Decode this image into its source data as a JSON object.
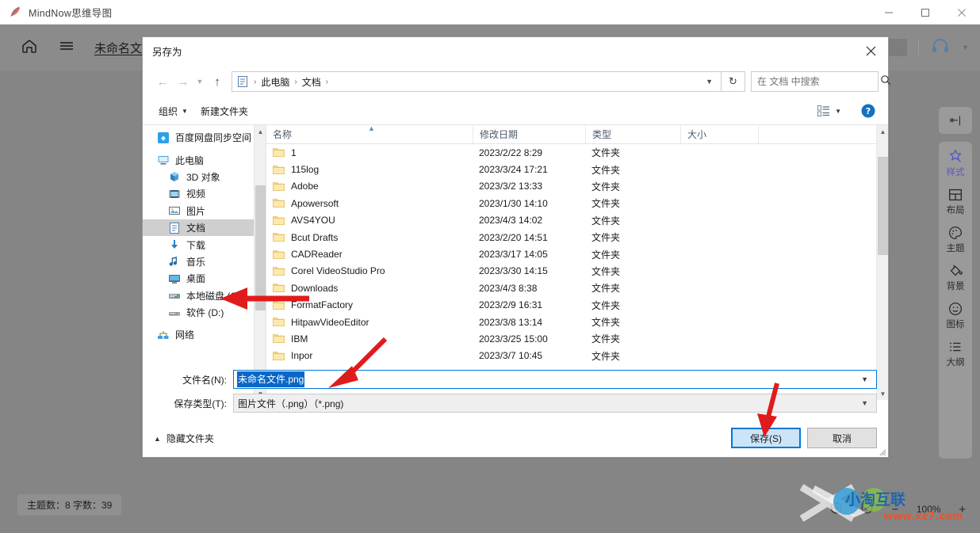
{
  "app": {
    "title": "MindNow思维导图",
    "logo_icon": "feather-logo-icon",
    "window_controls": {
      "minimize": "minimize-icon",
      "maximize": "maximize-icon",
      "close": "close-icon"
    },
    "header": {
      "home_icon": "home-icon",
      "menu_icon": "hamburger-menu-icon",
      "document_name": "未命名文件",
      "headset_icon": "headset-icon",
      "headset_caret": "chevron-down-icon"
    },
    "rail": {
      "collapse_icon": "collapse-panel-icon",
      "items": [
        {
          "label": "样式",
          "icon": "star-style-icon",
          "active": true
        },
        {
          "label": "布局",
          "icon": "layout-grid-icon",
          "active": false
        },
        {
          "label": "主题",
          "icon": "palette-theme-icon",
          "active": false
        },
        {
          "label": "背景",
          "icon": "paint-bucket-icon",
          "active": false
        },
        {
          "label": "图标",
          "icon": "smiley-face-icon",
          "active": false
        },
        {
          "label": "大纲",
          "icon": "outline-list-icon",
          "active": false
        }
      ]
    },
    "status": {
      "left_text": "主题数：8  字数：39",
      "globe_icon": "globe-icon",
      "compass_icon": "compass-icon",
      "zoom_out": "−",
      "zoom_level": "100%",
      "zoom_in": "+"
    },
    "watermark": {
      "brand": "小淘互联",
      "url": "www.xz7.com"
    }
  },
  "dialog": {
    "title": "另存为",
    "close_icon": "close-icon",
    "nav": {
      "back_icon": "arrow-left-icon",
      "forward_icon": "arrow-right-icon",
      "history_icon": "chevron-down-icon",
      "up_icon": "arrow-up-icon",
      "breadcrumb_icon": "documents-folder-icon",
      "crumbs": [
        "此电脑",
        "文档"
      ],
      "breadcrumb_caret": "chevron-down-icon",
      "refresh_icon": "refresh-icon",
      "search_placeholder": "在 文档 中搜索",
      "search_value": "",
      "search_icon": "search-icon"
    },
    "commands": {
      "organize_label": "组织",
      "organize_caret": "chevron-down-icon",
      "new_folder_label": "新建文件夹",
      "view_icon": "view-mode-icon",
      "view_caret": "chevron-down-icon",
      "help_icon": "help-question-icon"
    },
    "nav_pane": {
      "items": [
        {
          "label": "百度网盘同步空间",
          "icon": "baidu-netdisk-icon",
          "indent": false,
          "selected": false
        },
        {
          "label": "此电脑",
          "icon": "this-pc-icon",
          "indent": false,
          "selected": false
        },
        {
          "label": "3D 对象",
          "icon": "3d-objects-icon",
          "indent": true,
          "selected": false
        },
        {
          "label": "视频",
          "icon": "videos-folder-icon",
          "indent": true,
          "selected": false
        },
        {
          "label": "图片",
          "icon": "pictures-folder-icon",
          "indent": true,
          "selected": false
        },
        {
          "label": "文档",
          "icon": "documents-folder-icon",
          "indent": true,
          "selected": true
        },
        {
          "label": "下载",
          "icon": "downloads-folder-icon",
          "indent": true,
          "selected": false
        },
        {
          "label": "音乐",
          "icon": "music-folder-icon",
          "indent": true,
          "selected": false
        },
        {
          "label": "桌面",
          "icon": "desktop-folder-icon",
          "indent": true,
          "selected": false
        },
        {
          "label": "本地磁盘 (C:)",
          "icon": "hard-drive-icon",
          "indent": true,
          "selected": false
        },
        {
          "label": "软件 (D:)",
          "icon": "hard-drive-icon",
          "indent": true,
          "selected": false
        },
        {
          "label": "网络",
          "icon": "network-icon",
          "indent": false,
          "selected": false
        }
      ],
      "scroll_up_icon": "chevron-up-icon",
      "scroll_down_icon": "chevron-down-icon"
    },
    "file_list": {
      "columns": [
        "名称",
        "修改日期",
        "类型",
        "大小"
      ],
      "sort_indicator": "sort-ascending-icon",
      "rows": [
        {
          "name": "1",
          "date": "2023/2/22 8:29",
          "type": "文件夹",
          "size": ""
        },
        {
          "name": "115log",
          "date": "2023/3/24 17:21",
          "type": "文件夹",
          "size": ""
        },
        {
          "name": "Adobe",
          "date": "2023/3/2 13:33",
          "type": "文件夹",
          "size": ""
        },
        {
          "name": "Apowersoft",
          "date": "2023/1/30 14:10",
          "type": "文件夹",
          "size": ""
        },
        {
          "name": "AVS4YOU",
          "date": "2023/4/3 14:02",
          "type": "文件夹",
          "size": ""
        },
        {
          "name": "Bcut Drafts",
          "date": "2023/2/20 14:51",
          "type": "文件夹",
          "size": ""
        },
        {
          "name": "CADReader",
          "date": "2023/3/17 14:05",
          "type": "文件夹",
          "size": ""
        },
        {
          "name": "Corel VideoStudio Pro",
          "date": "2023/3/30 14:15",
          "type": "文件夹",
          "size": ""
        },
        {
          "name": "Downloads",
          "date": "2023/4/3 8:38",
          "type": "文件夹",
          "size": ""
        },
        {
          "name": "FormatFactory",
          "date": "2023/2/9 16:31",
          "type": "文件夹",
          "size": ""
        },
        {
          "name": "HitpawVideoEditor",
          "date": "2023/3/8 13:14",
          "type": "文件夹",
          "size": ""
        },
        {
          "name": "IBM",
          "date": "2023/3/25 15:00",
          "type": "文件夹",
          "size": ""
        },
        {
          "name": "Inpor",
          "date": "2023/3/7 10:45",
          "type": "文件夹",
          "size": ""
        }
      ],
      "scroll_up_icon": "chevron-up-icon",
      "scroll_down_icon": "chevron-down-icon"
    },
    "form": {
      "filename_label": "文件名(N):",
      "filename_value": "未命名文件.png",
      "filename_caret": "chevron-down-icon",
      "savetype_label": "保存类型(T):",
      "savetype_value": "图片文件（.png）（*.png)",
      "savetype_caret": "chevron-down-icon"
    },
    "footer": {
      "hide_folders_label": "隐藏文件夹",
      "hide_folders_caret": "chevron-up-icon",
      "save_label": "保存(S)",
      "cancel_label": "取消"
    }
  },
  "colors": {
    "accent": "#0078d7",
    "selection": "#0a67c7",
    "rail_active": "#5b57c4",
    "annotation": "#e01b1b",
    "scrim": "#828282"
  }
}
